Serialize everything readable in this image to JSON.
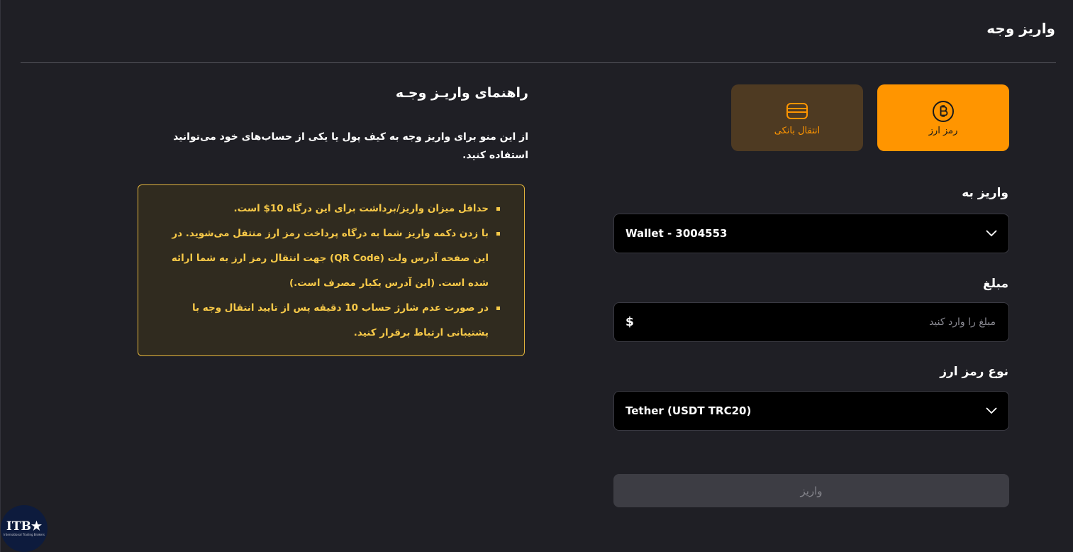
{
  "header": {
    "title": "واریز وجه"
  },
  "methods": {
    "crypto_label": "رمز ارز",
    "bank_label": "انتقال بانکی"
  },
  "form": {
    "deposit_to_label": "واریز به",
    "deposit_to_value": "Wallet - 3004553",
    "amount_label": "مبلغ",
    "amount_placeholder": "مبلغ را وارد کنید",
    "amount_currency": "$",
    "crypto_type_label": "نوع رمز ارز",
    "crypto_type_value": "Tether (USDT TRC20)",
    "submit_label": "واریز"
  },
  "guide": {
    "title": "راهنمای واریـز وجـه",
    "description": "از این منو برای واریز وجه به کیف پول یا یکی از حساب‌های خود می‌توانید استفاده کنید.",
    "notices": [
      "حداقل میزان واریز/برداشت برای این درگاه 10$ است.",
      "با زدن دکمه واریز شما به درگاه پرداخت رمز ارز منتقل می‌شوید. در این صفحه آدرس ولت (QR Code) جهت انتقال رمز ارز به شما ارائه شده است. (این آدرس یکبار مصرف است.)",
      "در صورت عدم شارژ حساب 10 دقیقه پس از تایید انتقال وجه با پشتیبانی ارتباط برقرار کنید."
    ]
  },
  "logo": {
    "text": "ITB★",
    "subtext": "International Trading Brokers"
  },
  "colors": {
    "accent": "#ff9500",
    "notice": "#f7c948",
    "background": "#1f1f25"
  },
  "icons": {
    "crypto": "bitcoin-icon",
    "bank": "credit-card-icon",
    "select": "chevron-down-icon"
  }
}
